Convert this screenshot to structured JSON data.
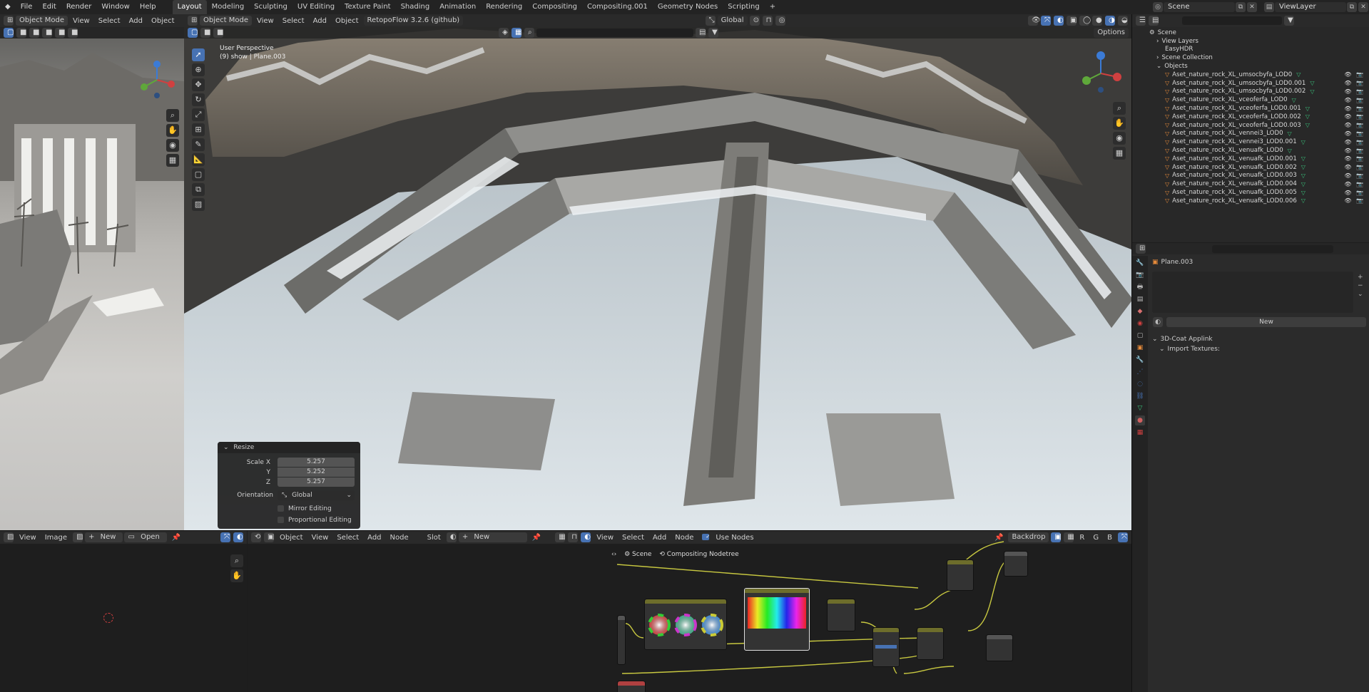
{
  "menu": {
    "items": [
      "File",
      "Edit",
      "Render",
      "Window",
      "Help"
    ]
  },
  "workspaces": {
    "tabs": [
      "Layout",
      "Modeling",
      "Sculpting",
      "UV Editing",
      "Texture Paint",
      "Shading",
      "Animation",
      "Rendering",
      "Compositing",
      "Compositing.001",
      "Geometry Nodes",
      "Scripting"
    ],
    "add": "+"
  },
  "scene_selector": {
    "label": "Scene",
    "view_layer": "ViewLayer"
  },
  "left_viewport": {
    "mode": "Object Mode",
    "menu": [
      "View",
      "Select",
      "Add",
      "Object"
    ]
  },
  "main_viewport": {
    "mode": "Object Mode",
    "menu": [
      "View",
      "Select",
      "Add",
      "Object"
    ],
    "addon": "RetopoFlow 3.2.6 (github)",
    "orientation": "Global",
    "options": "Options",
    "info_line1": "User Perspective",
    "info_line2": "(9) show | Plane.003"
  },
  "resize_panel": {
    "title": "Resize",
    "scale_x_label": "Scale X",
    "scale_x": "5.257",
    "y_label": "Y",
    "scale_y": "5.252",
    "z_label": "Z",
    "scale_z": "5.257",
    "orientation_label": "Orientation",
    "orientation": "Global",
    "mirror": "Mirror Editing",
    "proportional": "Proportional Editing"
  },
  "outliner": {
    "root": "Scene",
    "items": [
      {
        "label": "View Layers",
        "indent": 1
      },
      {
        "label": "EasyHDR",
        "indent": 1
      },
      {
        "label": "Scene Collection",
        "indent": 1
      },
      {
        "label": "Objects",
        "indent": 1
      }
    ],
    "objects": [
      "Aset_nature_rock_XL_umsocbyfa_LOD0",
      "Aset_nature_rock_XL_umsocbyfa_LOD0.001",
      "Aset_nature_rock_XL_umsocbyfa_LOD0.002",
      "Aset_nature_rock_XL_vceoferfa_LOD0",
      "Aset_nature_rock_XL_vceoferfa_LOD0.001",
      "Aset_nature_rock_XL_vceoferfa_LOD0.002",
      "Aset_nature_rock_XL_vceoferfa_LOD0.003",
      "Aset_nature_rock_XL_vennei3_LOD0",
      "Aset_nature_rock_XL_vennei3_LOD0.001",
      "Aset_nature_rock_XL_venuafk_LOD0",
      "Aset_nature_rock_XL_venuafk_LOD0.001",
      "Aset_nature_rock_XL_venuafk_LOD0.002",
      "Aset_nature_rock_XL_venuafk_LOD0.003",
      "Aset_nature_rock_XL_venuafk_LOD0.004",
      "Aset_nature_rock_XL_venuafk_LOD0.005",
      "Aset_nature_rock_XL_venuafk_LOD0.006"
    ]
  },
  "properties": {
    "object_name": "Plane.003",
    "new_button": "New",
    "addon_panel": "3D-Coat Applink",
    "import_textures": "Import Textures:"
  },
  "image_editor": {
    "menu": [
      "View",
      "Image"
    ],
    "new": "New",
    "open": "Open"
  },
  "node_editor": {
    "type": "Object",
    "menu": [
      "View",
      "Select",
      "Add",
      "Node"
    ],
    "slot": "Slot",
    "new": "New",
    "menu2": [
      "View",
      "Select",
      "Add",
      "Node"
    ],
    "use_nodes": "Use Nodes",
    "backdrop": "Backdrop",
    "channels": [
      "R",
      "G",
      "B"
    ],
    "breadcrumb_scene": "Scene",
    "breadcrumb_tree": "Compositing Nodetree"
  },
  "colors": {
    "accent": "#4772b3",
    "panel": "#2a2a2a",
    "bg": "#1d1d1d",
    "node_link": "#c8c840"
  }
}
